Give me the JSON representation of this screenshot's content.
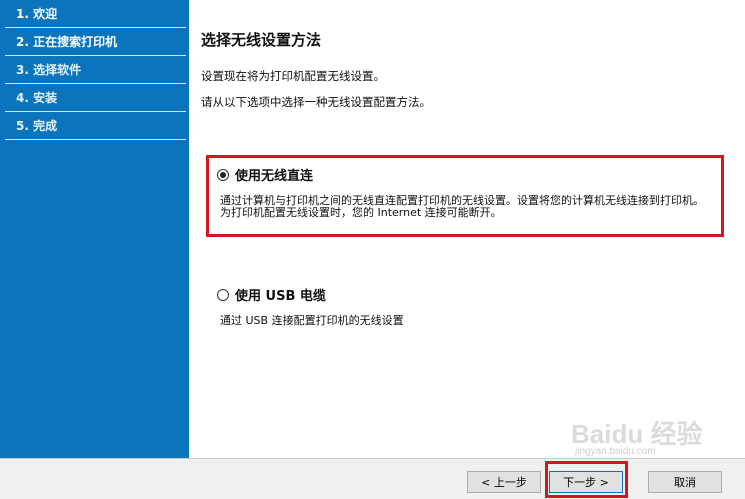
{
  "sidebar": {
    "steps": [
      {
        "label": "1. 欢迎"
      },
      {
        "label": "2. 正在搜索打印机"
      },
      {
        "label": "3. 选择软件"
      },
      {
        "label": "4. 安装"
      },
      {
        "label": "5. 完成"
      }
    ]
  },
  "main": {
    "title": "选择无线设置方法",
    "intro_1": "设置现在将为打印机配置无线设置。",
    "intro_2": "请从以下选项中选择一种无线设置配置方法。",
    "option_wireless": {
      "label": "使用无线直连",
      "checked": true,
      "desc_1": "通过计算机与打印机之间的无线直连配置打印机的无线设置。设置将您的计算机无线连接到打印机。",
      "desc_2": "为打印机配置无线设置时，您的 Internet 连接可能断开。"
    },
    "option_usb": {
      "label": "使用 USB 电缆",
      "checked": false,
      "desc": "通过 USB 连接配置打印机的无线设置"
    }
  },
  "footer": {
    "back_label": "< 上一步",
    "next_label": "下一步 >",
    "cancel_label": "取消"
  },
  "watermark": {
    "text": "Baidu 经验",
    "sub": "jingyan.baidu.com"
  },
  "colors": {
    "sidebar_bg": "#0a75bd",
    "highlight": "#d6161e"
  }
}
